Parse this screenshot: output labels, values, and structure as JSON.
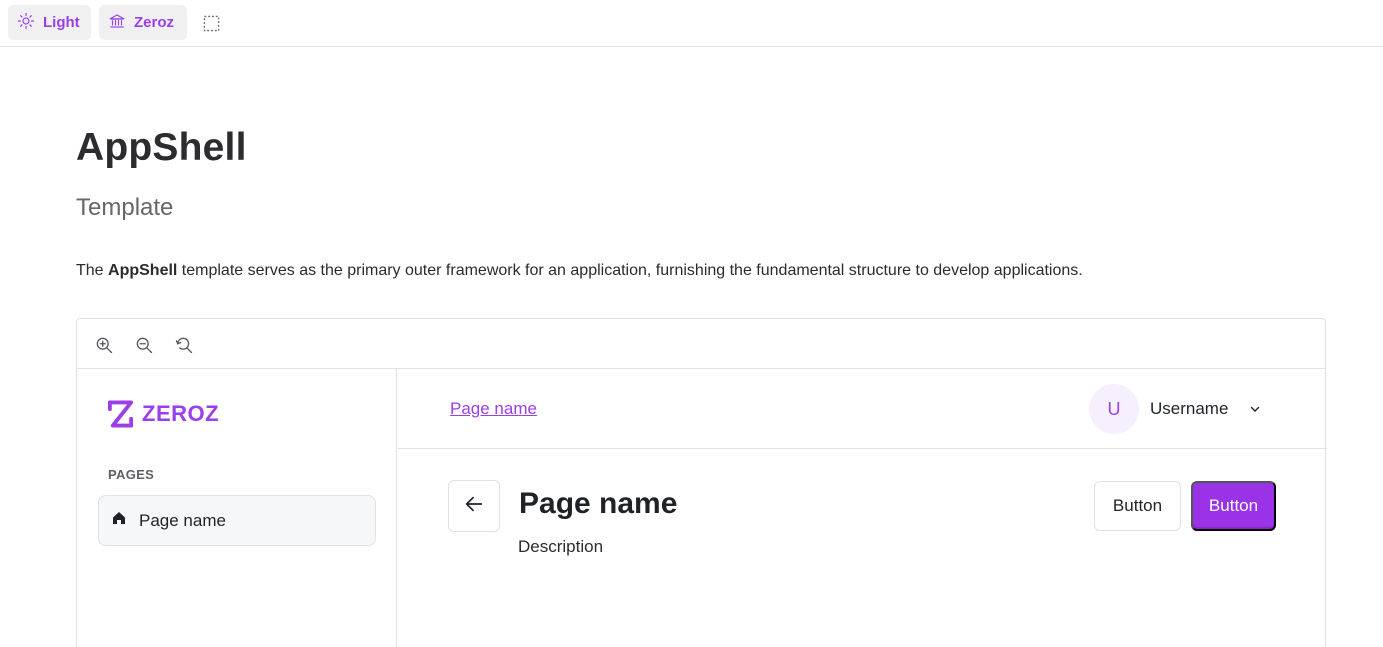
{
  "toolbar": {
    "theme_label": "Light",
    "theme_icon": "sun-icon",
    "brand_label": "Zeroz",
    "brand_icon": "bank-icon",
    "outline_icon": "outline-toggle-icon",
    "accent": "#9b3fe8"
  },
  "header": {
    "title": "AppShell",
    "subtitle": "Template",
    "description_prefix": "The ",
    "description_bold": "AppShell",
    "description_suffix": " template serves as the primary outer framework for an application, furnishing the fundamental structure to develop applications."
  },
  "preview": {
    "tools": [
      "zoom-in-icon",
      "zoom-out-icon",
      "reset-zoom-icon"
    ],
    "sidebar": {
      "logo_text": "ZEROZ",
      "section_label": "PAGES",
      "items": [
        {
          "label": "Page name",
          "icon": "home-icon"
        }
      ]
    },
    "topbar": {
      "breadcrumb": "Page name",
      "avatar_initial": "U",
      "username": "Username"
    },
    "page": {
      "title": "Page name",
      "description": "Description",
      "secondary_button": "Button",
      "primary_button": "Button",
      "primary_color": "#9a32e8"
    }
  }
}
